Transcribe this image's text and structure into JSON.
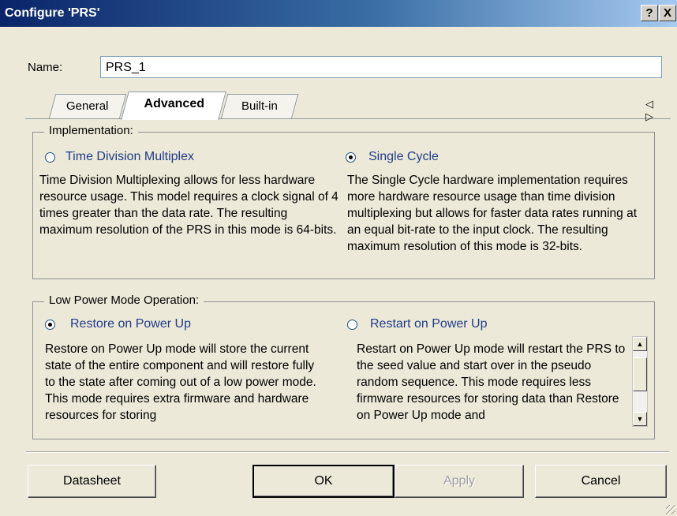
{
  "window": {
    "title": "Configure 'PRS'",
    "help_label": "?",
    "close_label": "X"
  },
  "name_field": {
    "label": "Name:",
    "value": "PRS_1"
  },
  "tabs": [
    {
      "label": "General"
    },
    {
      "label": "Advanced"
    },
    {
      "label": "Built-in"
    }
  ],
  "tab_arrows": "◁ ▷",
  "implementation": {
    "legend": "Implementation:",
    "options": [
      {
        "label": "Time Division Multiplex",
        "checked": false,
        "description": "Time Division Multiplexing allows for less hardware resource usage.  This model requires a clock signal of 4 times greater than the data rate.  The  resulting maximum resolution of the PRS in this mode is 64-bits."
      },
      {
        "label": "Single Cycle",
        "checked": true,
        "description": "The Single Cycle hardware implementation requires more hardware resource usage than time division multiplexing but allows for faster data rates running at an equal bit-rate to the input clock.  The resulting maximum resolution of this mode is 32-bits."
      }
    ]
  },
  "low_power": {
    "legend": "Low Power Mode Operation:",
    "options": [
      {
        "label": "Restore on Power Up",
        "checked": true,
        "description": "Restore on Power Up mode will store the current state of the entire component and will restore fully to the state after coming out of a low power mode. This mode requires extra firmware and hardware resources for storing"
      },
      {
        "label": "Restart on Power Up",
        "checked": false,
        "description": "Restart on Power Up mode will restart the PRS to the seed value and start over in the pseudo random sequence.  This mode requires less firmware resources for storing data than Restore on Power Up mode and"
      }
    ]
  },
  "buttons": {
    "datasheet": "Datasheet",
    "ok": "OK",
    "apply": "Apply",
    "cancel": "Cancel"
  }
}
